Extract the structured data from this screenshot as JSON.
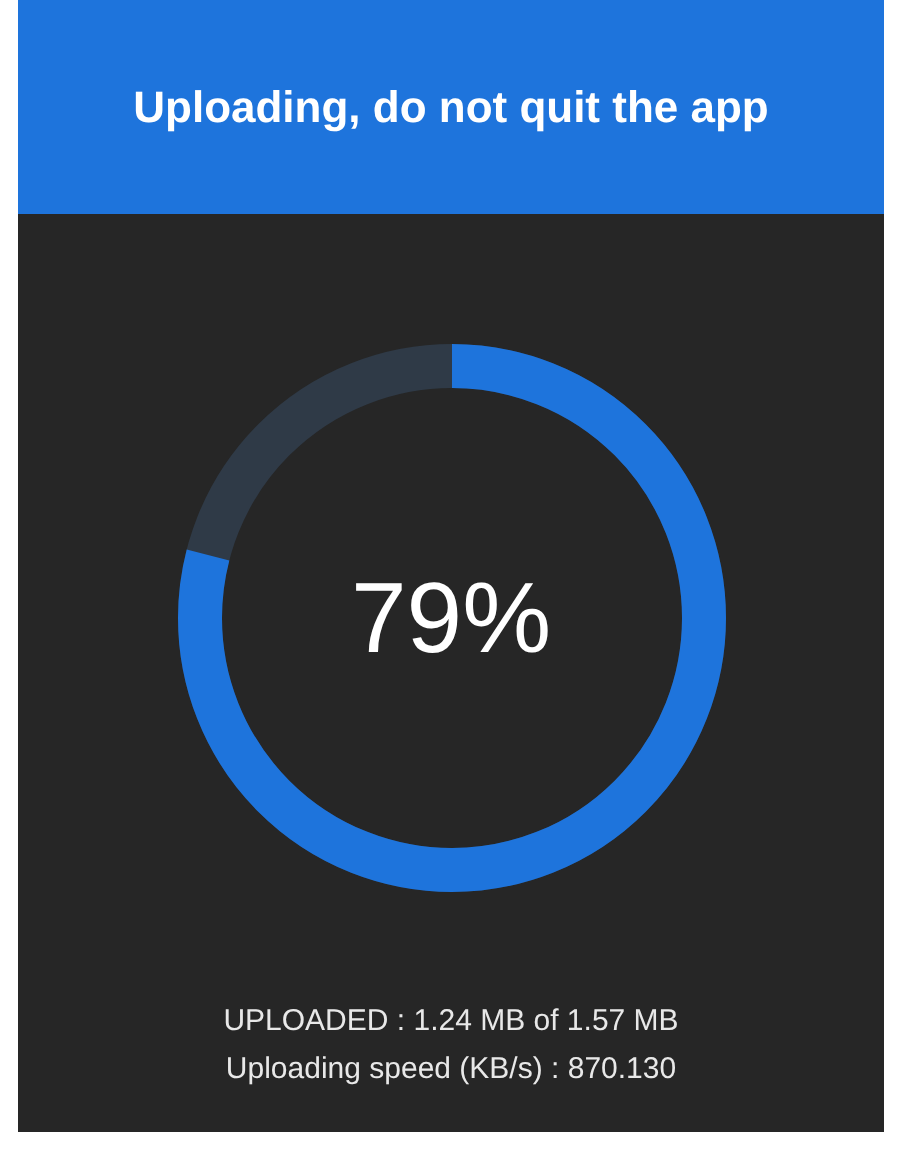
{
  "header": {
    "title": "Uploading, do not quit the app"
  },
  "progress": {
    "level": 0.79,
    "label": "79%"
  },
  "details": [
    "UPLOADED : 1.24 MB of 1.57 MB",
    "Uploading speed (KB/s) : 870.130"
  ]
}
